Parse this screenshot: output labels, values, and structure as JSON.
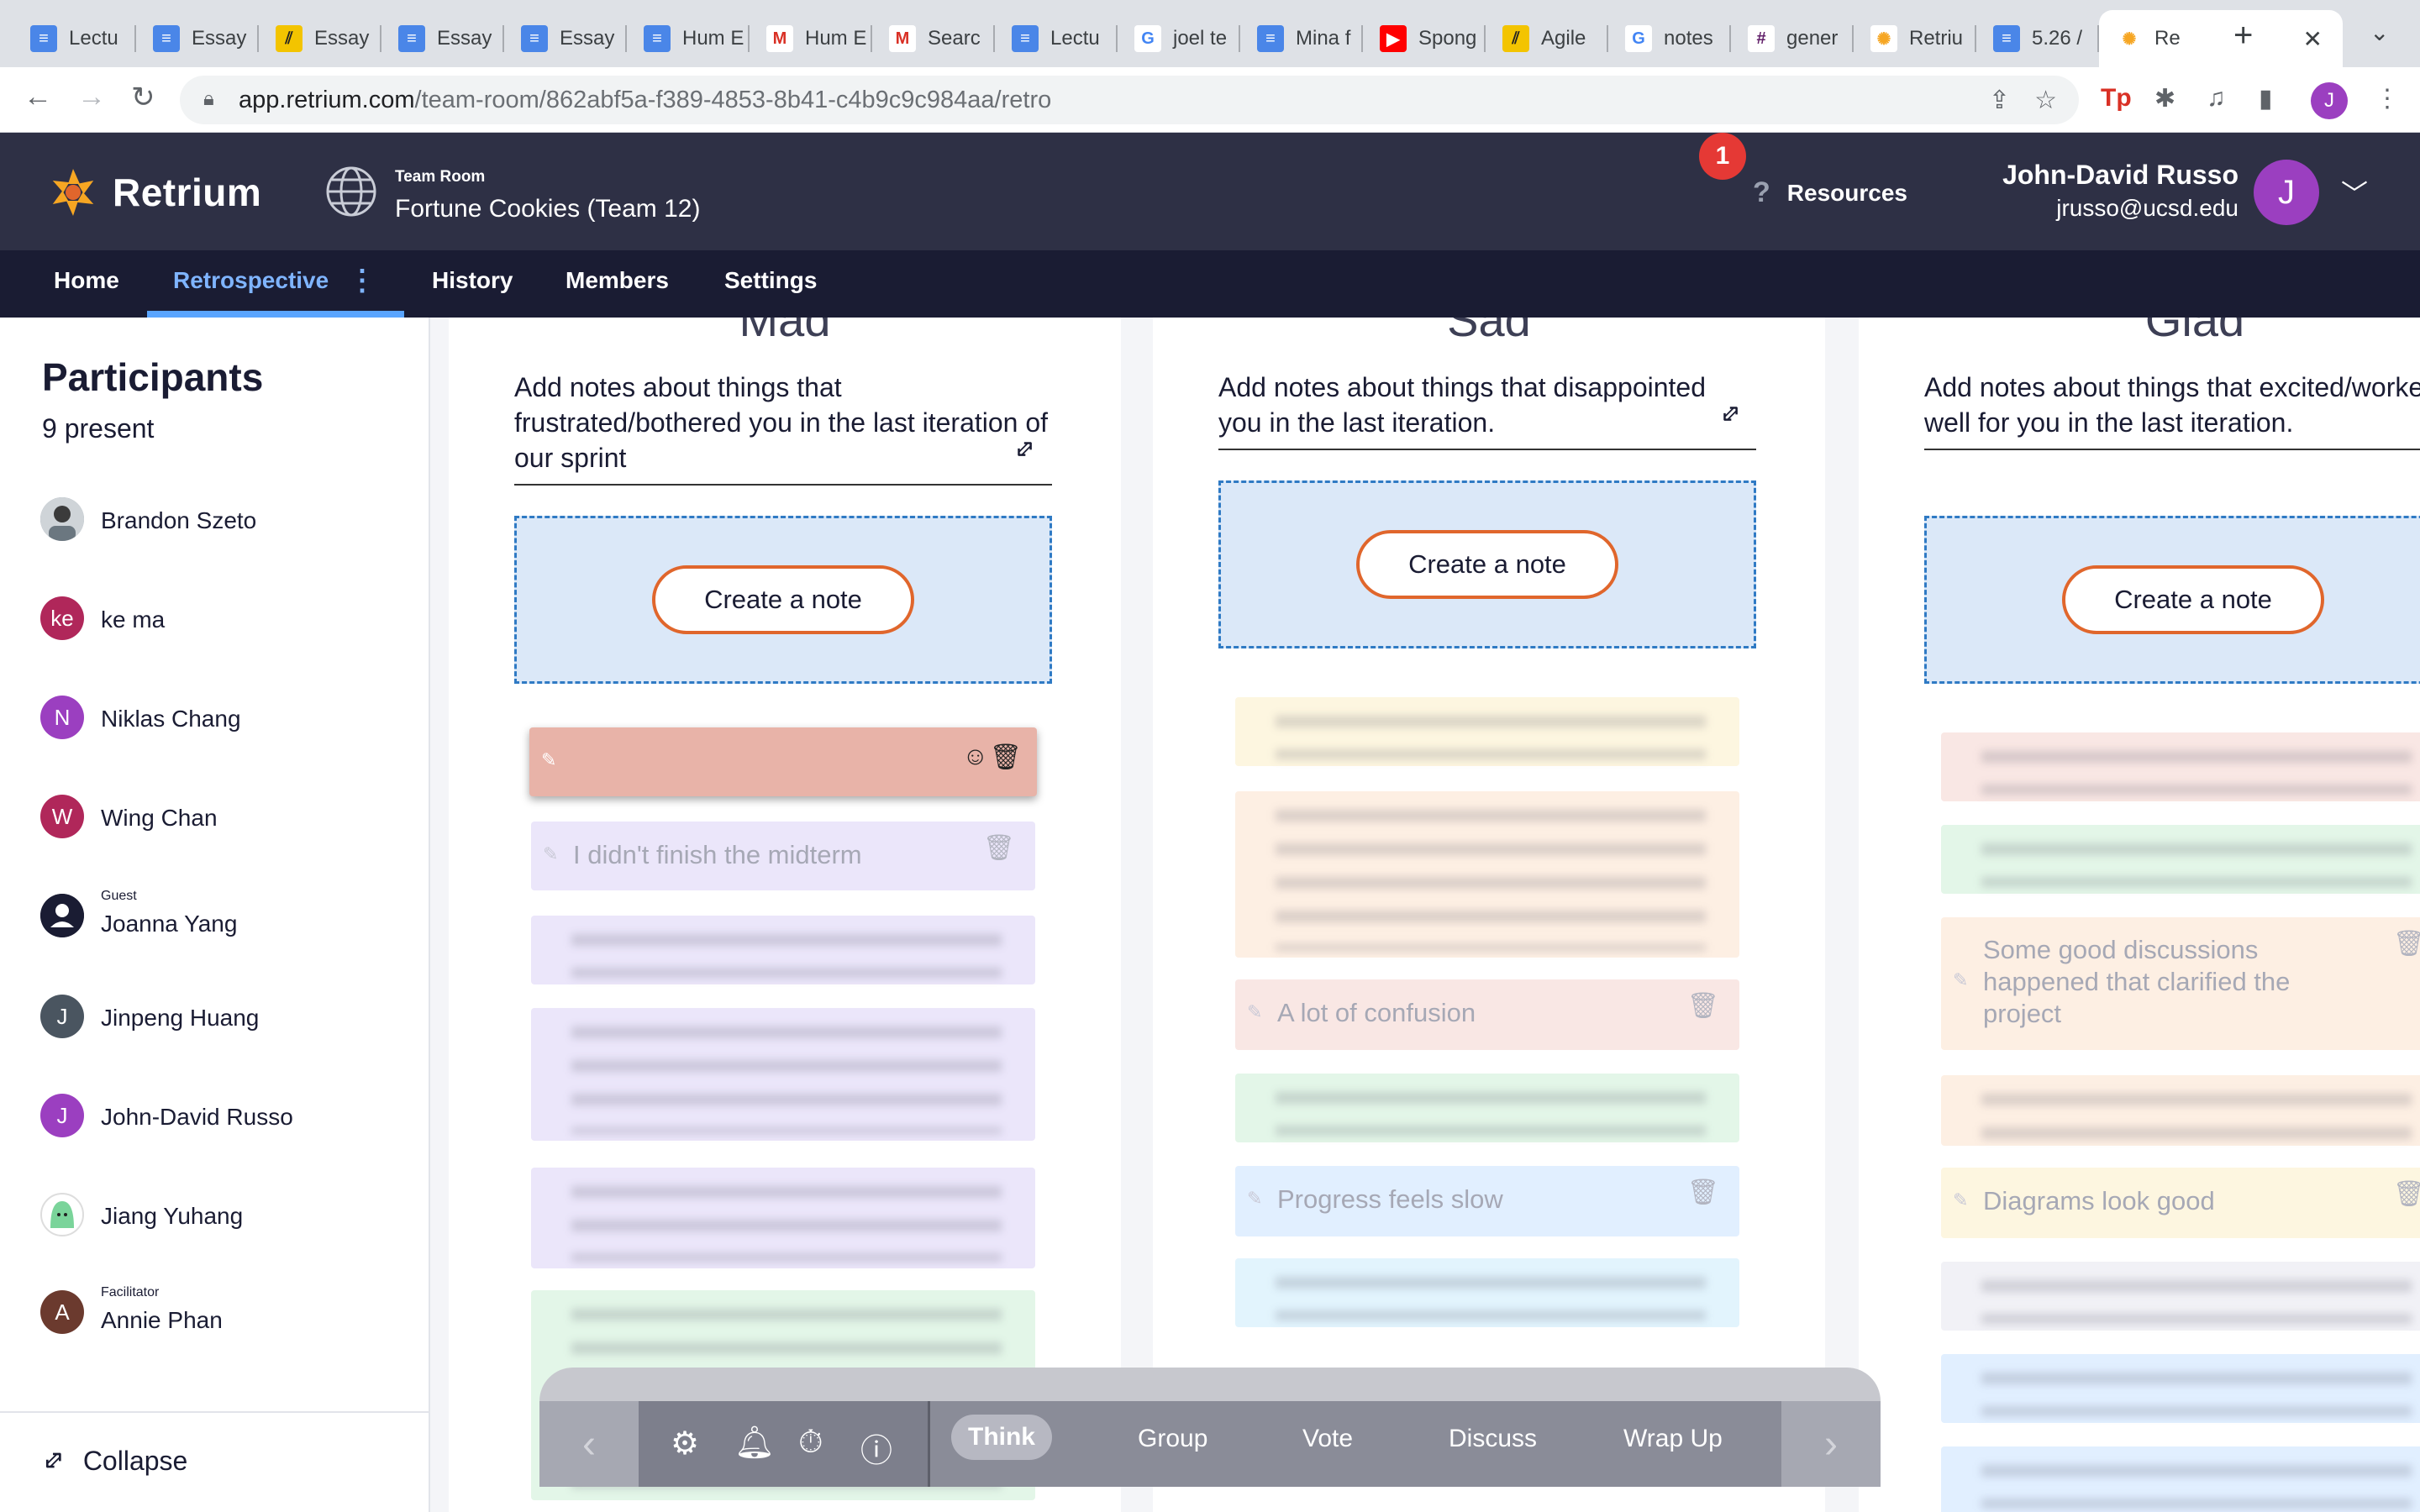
{
  "browser": {
    "tabs": [
      {
        "label": "Lectu",
        "icon": "google-docs-icon"
      },
      {
        "label": "Essay",
        "icon": "google-docs-icon"
      },
      {
        "label": "Essay",
        "icon": "agile-icon"
      },
      {
        "label": "Essay",
        "icon": "google-docs-icon"
      },
      {
        "label": "Essay",
        "icon": "google-docs-icon"
      },
      {
        "label": "Hum E",
        "icon": "google-docs-icon"
      },
      {
        "label": "Hum E",
        "icon": "gmail-icon"
      },
      {
        "label": "Searc",
        "icon": "gmail-icon"
      },
      {
        "label": "Lectu",
        "icon": "google-docs-icon"
      },
      {
        "label": "joel te",
        "icon": "google-icon"
      },
      {
        "label": "Mina f",
        "icon": "google-docs-icon"
      },
      {
        "label": "Spong",
        "icon": "youtube-icon"
      },
      {
        "label": "Agile",
        "icon": "agile-icon"
      },
      {
        "label": "notes",
        "icon": "google-icon"
      },
      {
        "label": "gener",
        "icon": "slack-icon"
      },
      {
        "label": "Retriu",
        "icon": "retrium-icon"
      },
      {
        "label": "5.26 /",
        "icon": "google-docs-icon"
      },
      {
        "label": "Re",
        "icon": "retrium-icon"
      }
    ],
    "url_host": "app.retrium.com",
    "url_path": "/team-room/862abf5a-f389-4853-8b41-c4b9c9c984aa/retro"
  },
  "header": {
    "logo_text": "Retrium",
    "room_kicker": "Team Room",
    "room_name": "Fortune Cookies (Team 12)",
    "notification_count": "1",
    "resources_label": "Resources",
    "user_name": "John-David Russo",
    "user_email": "jrusso@ucsd.edu",
    "user_initial": "J"
  },
  "nav": {
    "home": "Home",
    "retrospective": "Retrospective",
    "history": "History",
    "members": "Members",
    "settings": "Settings"
  },
  "sidebar": {
    "title": "Participants",
    "count": "9 present",
    "participants": [
      {
        "name": "Brandon Szeto",
        "initial": "",
        "color": "#8d9aa5",
        "role": ""
      },
      {
        "name": "ke ma",
        "initial": "ke",
        "color": "#b0275a",
        "role": ""
      },
      {
        "name": "Niklas Chang",
        "initial": "N",
        "color": "#9b3fc0",
        "role": ""
      },
      {
        "name": "Wing Chan",
        "initial": "W",
        "color": "#b0275a",
        "role": ""
      },
      {
        "name": "Joanna Yang",
        "initial": "",
        "color": "#1a1c33",
        "role": "Guest"
      },
      {
        "name": "Jinpeng Huang",
        "initial": "J",
        "color": "#4a5560",
        "role": ""
      },
      {
        "name": "John-David Russo",
        "initial": "J",
        "color": "#9b3fc0",
        "role": ""
      },
      {
        "name": "Jiang Yuhang",
        "initial": "",
        "color": "#ffffff",
        "role": ""
      },
      {
        "name": "Annie Phan",
        "initial": "A",
        "color": "#6b3a2e",
        "role": "Facilitator"
      }
    ],
    "collapse_label": "Collapse"
  },
  "columns": [
    {
      "title": "Mad",
      "description": "Add notes about things that frustrated/bothered you in the last iteration of our sprint",
      "create_label": "Create a note",
      "notes": [
        {
          "text": "",
          "blurred": false,
          "color": "#e8b3a8"
        },
        {
          "text": "I didn't finish the midterm",
          "blurred": false,
          "color": "#ebe6fa"
        },
        {
          "text": "",
          "blurred": true,
          "color": "#ebe6fa"
        },
        {
          "text": "",
          "blurred": true,
          "color": "#ebe6fa"
        },
        {
          "text": "",
          "blurred": true,
          "color": "#ebe6fa"
        },
        {
          "text": "",
          "blurred": true,
          "color": "#e3f6e8"
        }
      ]
    },
    {
      "title": "Sad",
      "description": "Add notes about things that disappointed you in the last iteration.",
      "create_label": "Create a note",
      "notes": [
        {
          "text": "",
          "blurred": true,
          "color": "#fdf6e0"
        },
        {
          "text": "",
          "blurred": true,
          "color": "#fdefe3"
        },
        {
          "text": "A lot of confusion",
          "blurred": false,
          "color": "#f9e7e4"
        },
        {
          "text": "",
          "blurred": true,
          "color": "#e3f6e8"
        },
        {
          "text": "Progress feels slow",
          "blurred": false,
          "color": "#e1efff"
        },
        {
          "text": "",
          "blurred": true,
          "color": "#e2f4fd"
        }
      ]
    },
    {
      "title": "Glad",
      "description": "Add notes about things that excited/worked well for you in the last iteration.",
      "create_label": "Create a note",
      "notes": [
        {
          "text": "",
          "blurred": true,
          "color": "#f9e7e4"
        },
        {
          "text": "",
          "blurred": true,
          "color": "#e3f6e8"
        },
        {
          "text": "Some good discussions happened that clarified the project",
          "blurred": false,
          "color": "#fdefe3"
        },
        {
          "text": "",
          "blurred": true,
          "color": "#fdefe3"
        },
        {
          "text": "Diagrams look good",
          "blurred": false,
          "color": "#fdf6e0"
        },
        {
          "text": "",
          "blurred": true,
          "color": "#f1f1f6"
        },
        {
          "text": "",
          "blurred": true,
          "color": "#e1efff"
        },
        {
          "text": "",
          "blurred": true,
          "color": "#e1efff"
        }
      ]
    }
  ],
  "toolbar": {
    "phases": [
      "Think",
      "Group",
      "Vote",
      "Discuss",
      "Wrap Up"
    ],
    "current_phase": "Think"
  },
  "colors": {
    "header_bg": "#2e3045",
    "nav_bg": "#1a1c33",
    "accent_blue": "#5aa5ff",
    "create_btn_border": "#e0662c",
    "dropzone_bg": "#dbe8f8"
  }
}
